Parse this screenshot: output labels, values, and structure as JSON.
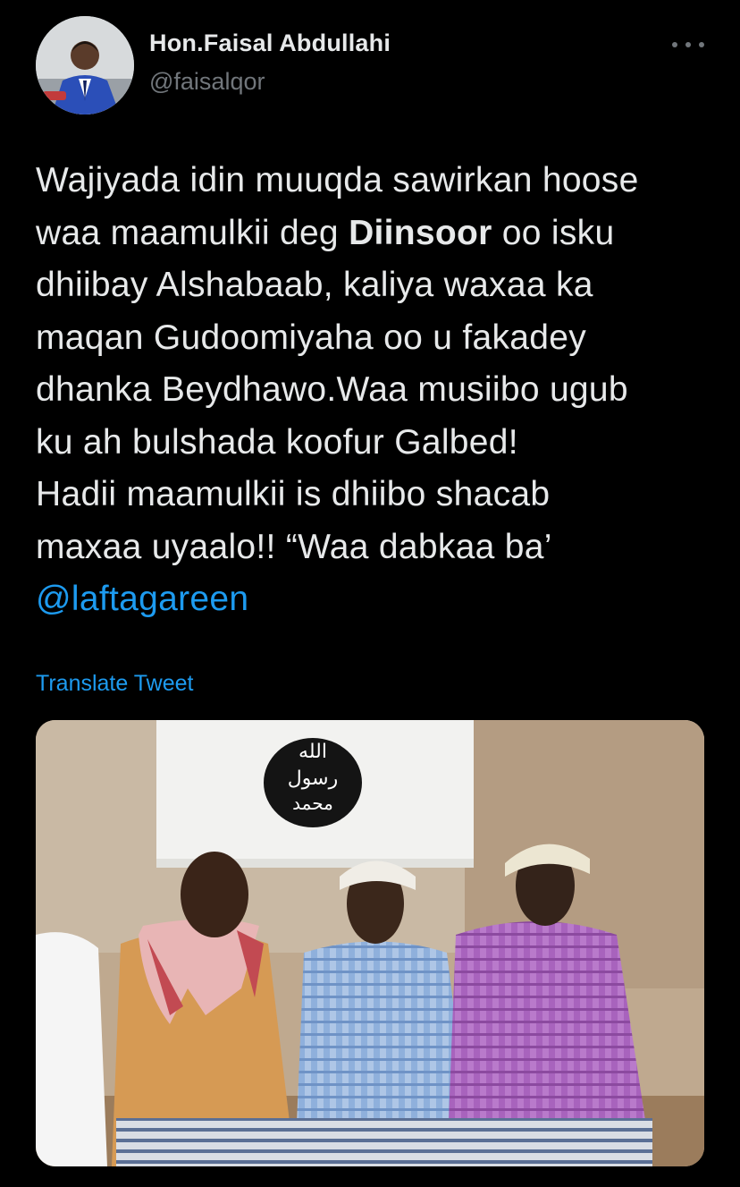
{
  "tweet": {
    "author_name": "Hon.Faisal Abdullahi",
    "author_handle": "@faisalqor",
    "text_before_bold": "Wajiyada idin muuqda sawirkan hoose\nwaa maamulkii deg ",
    "text_bold": "Diinsoor",
    "text_after_bold": " oo isku\ndhiibay Alshabaab, kaliya waxaa ka\nmaqan Gudoomiyaha oo u fakadey\ndhanka Beydhawo.Waa musiibo ugub\nku ah bulshada koofur Galbed!\nHadii maamulkii is dhiibo shacab\nmaxaa uyaalo!! “Waa dabkaa ba’\n",
    "mention": "@laftagareen",
    "translate_label": "Translate Tweet"
  },
  "icons": {
    "more": "more-horizontal-icon",
    "avatar": "profile-avatar"
  },
  "media": {
    "flag_text_line1": "الله",
    "flag_text_line2": "رسول",
    "flag_text_line3": "محمد"
  },
  "colors": {
    "background": "#000000",
    "text": "#e7e9ea",
    "secondary": "#71767b",
    "accent": "#1d9bf0"
  }
}
